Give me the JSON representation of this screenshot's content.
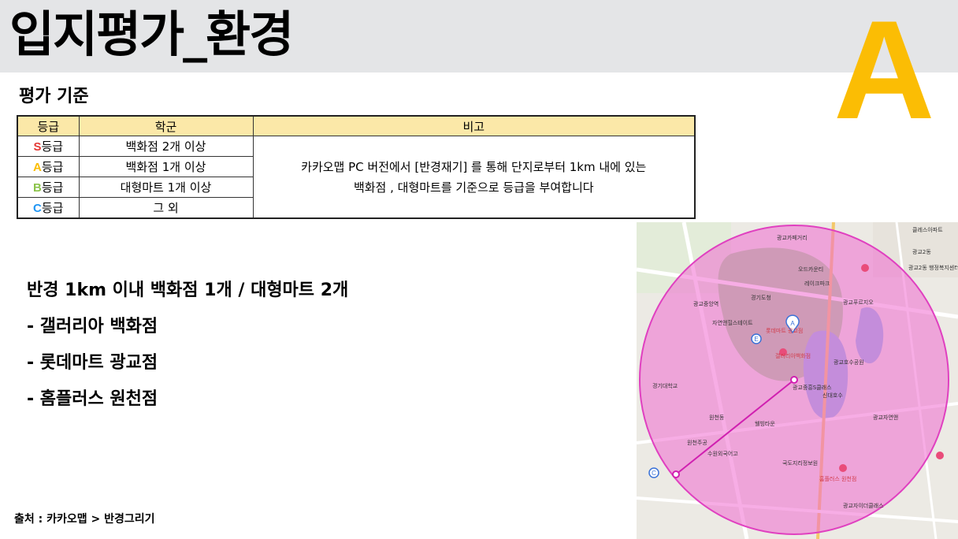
{
  "slide": {
    "title": "입지평가_환경",
    "grade": "A",
    "grade_color": "#fbbd04"
  },
  "criteria": {
    "heading": "평가 기준",
    "columns": [
      "등급",
      "학군",
      "비고"
    ],
    "rows": [
      {
        "letter": "S",
        "suffix": "등급",
        "letter_color": "#e53935",
        "condition": "백화점 2개 이상"
      },
      {
        "letter": "A",
        "suffix": "등급",
        "letter_color": "#fbbd04",
        "condition": "백화점 1개 이상"
      },
      {
        "letter": "B",
        "suffix": "등급",
        "letter_color": "#8bc34a",
        "condition": "대형마트 1개 이상"
      },
      {
        "letter": "C",
        "suffix": "등급",
        "letter_color": "#2196f3",
        "condition": "그 외"
      }
    ],
    "note_line1": "카카오맵 PC 버전에서 [반경재기] 를 통해 단지로부터 1km 내에 있는",
    "note_line2": "백화점 , 대형마트를 기준으로 등급을 부여합니다"
  },
  "result": {
    "summary": "반경 1km 이내 백화점 1개 / 대형마트 2개",
    "items": [
      "- 갤러리아 백화점",
      "- 롯데마트 광교점",
      "- 홈플러스 원천점"
    ]
  },
  "source": "출처 : 카카오맵 > 반경그리기",
  "map": {
    "circle_color": "#f06ad0",
    "labels": [
      "클레스아파트",
      "광교카페거리",
      "오드카운티",
      "광교2동 행정복지센터",
      "레이크파크",
      "광교푸르지오",
      "경기도청",
      "광교중앙역",
      "자연앤힐스테이트",
      "광교호수공원",
      "롯데마트 광교점",
      "갤러리아백화점",
      "광교중흥S클래스",
      "원천동",
      "홈플러스 원천점",
      "수원외국어고",
      "광교자연앤",
      "국도지리정보원",
      "광교자이더클래스",
      "원천주공",
      "경기대학교",
      "웰빙타운",
      "신대호수",
      "광교2동"
    ]
  }
}
